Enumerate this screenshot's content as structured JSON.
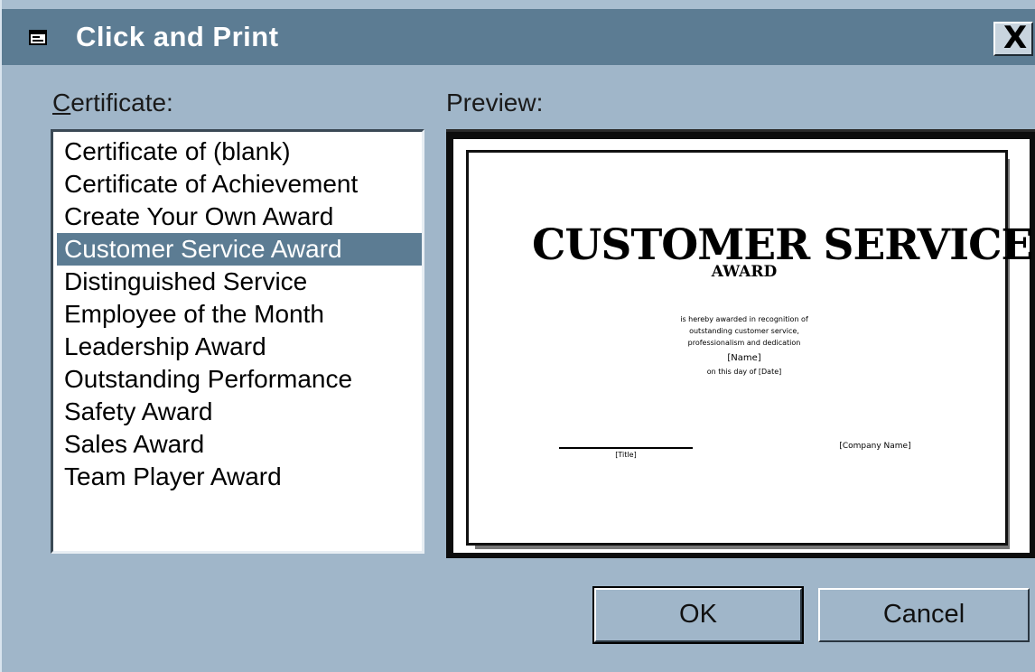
{
  "window": {
    "title": "Click and Print",
    "close_label": "X"
  },
  "certificate_label": {
    "accel": "C",
    "rest": "ertificate:"
  },
  "preview_label": "Preview:",
  "certificate_list": {
    "selected_index": 3,
    "items": [
      "Certificate of (blank)",
      "Certificate of Achievement",
      "Create Your Own Award",
      "Customer Service Award",
      "Distinguished Service",
      "Employee of the Month",
      "Leadership Award",
      "Outstanding Performance",
      "Safety Award",
      "Sales Award",
      "Team Player Award"
    ]
  },
  "preview": {
    "title": "CUSTOMER SERVICE",
    "subtitle": "AWARD",
    "body_lines": [
      "is hereby awarded in recognition of",
      "outstanding customer service,",
      "professionalism and dedication",
      "[Name]",
      "on this day of [Date]"
    ],
    "signature_left": "[Title]",
    "signature_right": "[Company Name]"
  },
  "buttons": {
    "ok": "OK",
    "cancel": "Cancel"
  },
  "colors": {
    "titlebar": "#5c7c93",
    "dialog_bg": "#a0b6c9",
    "selection": "#5c7c93"
  }
}
